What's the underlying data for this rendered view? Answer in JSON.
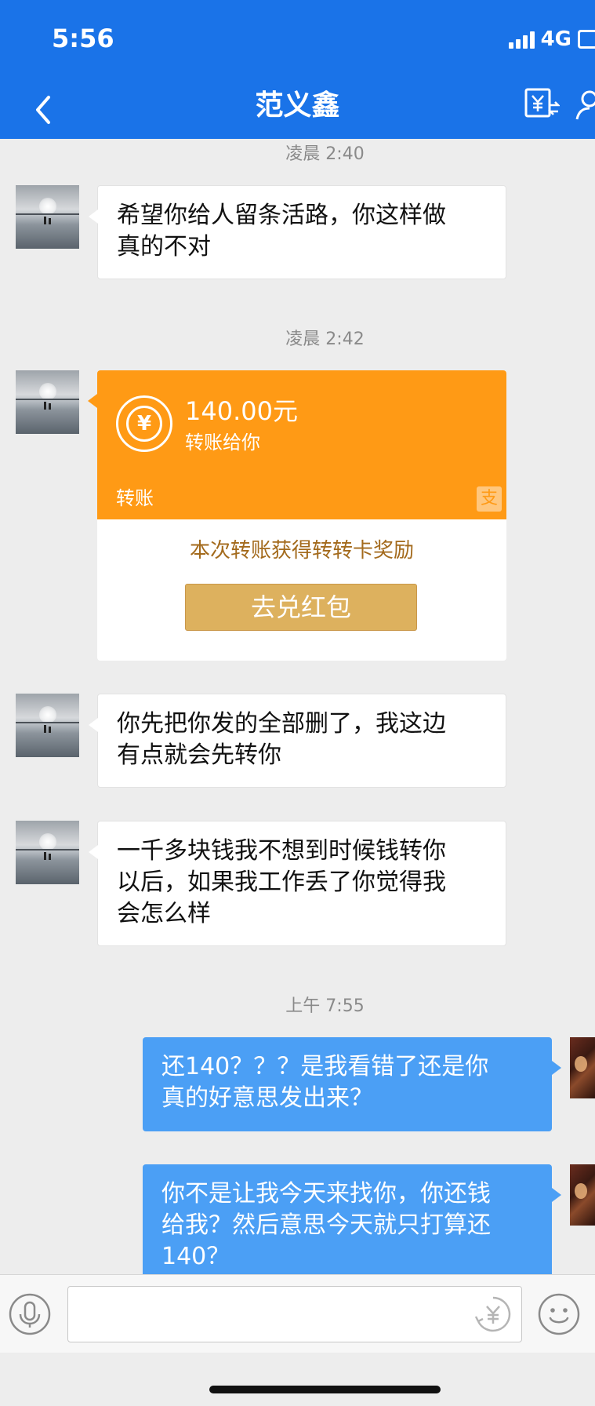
{
  "status_bar": {
    "time": "5:56",
    "network": "4G"
  },
  "nav": {
    "title": "范义鑫"
  },
  "messages": [
    {
      "time": "凌晨 2:40",
      "text_lines": [
        "希望你给人留条活路，你这样做",
        "真的不对"
      ]
    },
    {
      "time": "凌晨 2:42"
    },
    {
      "text_lines": [
        "你先把你发的全部删了，我这边",
        "有点就会先转你"
      ]
    },
    {
      "text_lines": [
        "一千多块钱我不想到时候钱转你",
        "以后，如果我工作丢了你觉得我",
        "会怎么样"
      ]
    },
    {
      "time": "上午 7:55",
      "text_lines": [
        "还140？？？是我看错了还是你",
        "真的好意思发出来？"
      ]
    },
    {
      "text_lines": [
        "你不是让我今天来找你，你还钱",
        "给我？然后意思今天就只打算还",
        "140？"
      ]
    }
  ],
  "transfer": {
    "amount": "140.00元",
    "subtitle": "转账给你",
    "type_label": "转账",
    "reward_text": "本次转账获得转转卡奖励",
    "button_label": "去兑红包"
  },
  "input": {
    "value": "",
    "placeholder": ""
  },
  "colors": {
    "nav_blue": "#1a73e8",
    "bubble_blue": "#4b9ff5",
    "transfer_orange": "#ff9a15",
    "button_gold": "#ddb15e"
  }
}
